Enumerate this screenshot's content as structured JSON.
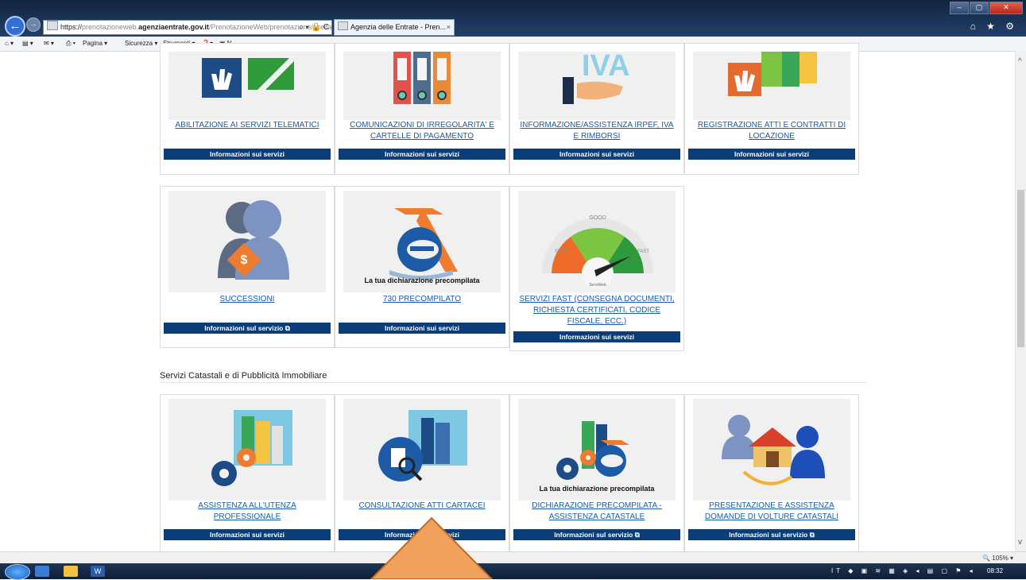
{
  "browser": {
    "address": {
      "prefix": "https://",
      "host_gray_1": "prenotazioneweb.",
      "host": "agenziaentrate.gov.it",
      "path": "/PrenotazioneWeb/prenotazione/scelta",
      "controls": "⌕ ▾ 🔒 C"
    },
    "tab": {
      "label": "Agenzia delle Entrate - Pren...",
      "close": "×"
    },
    "window_buttons": [
      "–",
      "▢",
      "✕"
    ],
    "right_icons": "⌂ ★ ⚙",
    "command_bar": {
      "home": "⌂ ▾",
      "feeds": "▤ ▾",
      "mail": "✉ ▾",
      "print": "⎙ ▾",
      "page": "Pagina ▾",
      "safety": "Sicurezza ▾",
      "tools": "Strumenti ▾",
      "help": "❓▾",
      "extra": "▣ N"
    },
    "zoom": "🔍 105%  ▾"
  },
  "taskbar": {
    "word_label": "W",
    "tray": "IT ◆ ▣ ≋ ▦ ◈ ◂ ▤ ▢ ⚑ ◂",
    "clock": "08:32"
  },
  "cards_top": [
    {
      "label": "ABILITAZIONE AI SERVIZI TELEMATICI",
      "button": "Informazioni sui servizi"
    },
    {
      "label": "COMUNICAZIONI DI IRREGOLARITA' E CARTELLE DI PAGAMENTO",
      "button": "Informazioni sui servizi"
    },
    {
      "label": "INFORMAZIONE/ASSISTENZA IRPEF, IVA E RIMBORSI",
      "button": "Informazioni sui servizi",
      "image_text": "IVA"
    },
    {
      "label": "REGISTRAZIONE ATTI E CONTRATTI DI LOCAZIONE",
      "button": "Informazioni sui servizi"
    }
  ],
  "cards_middle": [
    {
      "label": "SUCCESSIONI",
      "button": "Informazioni sul servizio ⧉"
    },
    {
      "label": "730 PRECOMPILATO",
      "button": "Informazioni sui servizi",
      "image_text": "La tua  dichiarazione precompilata"
    },
    {
      "label": "SERVIZI FAST (CONSEGNA DOCUMENTI, RICHIESTA CERTIFICATI, CODICE FISCALE, ECC.)",
      "button": "Informazioni sui servizi",
      "gauge": {
        "good": "GOOD",
        "slow": "SLOW",
        "fast": "FAST",
        "brand": "ServiWeb"
      }
    }
  ],
  "section_heading": "Servizi Catastali e di Pubblicità Immobiliare",
  "cards_bottom": [
    {
      "label": "ASSISTENZA ALL'UTENZA PROFESSIONALE",
      "button": "Informazioni sui servizi"
    },
    {
      "label": "CONSULTAZIONE ATTI CARTACEI",
      "button": "Informazioni sui servizi"
    },
    {
      "label": "DICHIARAZIONE PRECOMPILATA - ASSISTENZA CATASTALE",
      "button": "Informazioni sul servizio ⧉",
      "image_text": "La tua  dichiarazione precompilata"
    },
    {
      "label": "PRESENTAZIONE E ASSISTENZA DOMANDE DI VOLTURE CATASTALI",
      "button": "Informazioni sul servizio ⧉"
    }
  ],
  "colors": {
    "button_bg": "#0b3d78",
    "link": "#1a5ba8",
    "arrow": "#f0a15c"
  }
}
